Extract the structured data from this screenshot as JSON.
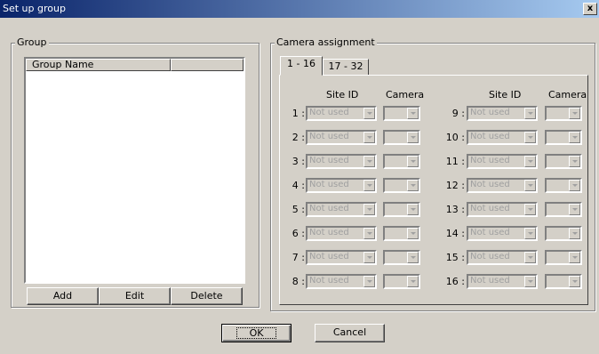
{
  "window": {
    "title": "Set up group",
    "close_label": "x"
  },
  "group": {
    "label": "Group",
    "columns": [
      "Group Name",
      ""
    ],
    "buttons": {
      "add": "Add",
      "edit": "Edit",
      "delete": "Delete"
    }
  },
  "camera": {
    "label": "Camera assignment",
    "tabs": [
      "1 - 16",
      "17 - 32"
    ],
    "headers": {
      "site": "Site ID",
      "camera": "Camera"
    },
    "left_rows": [
      {
        "label": "1 :",
        "site": "Not used"
      },
      {
        "label": "2 :",
        "site": "Not used"
      },
      {
        "label": "3 :",
        "site": "Not used"
      },
      {
        "label": "4 :",
        "site": "Not used"
      },
      {
        "label": "5 :",
        "site": "Not used"
      },
      {
        "label": "6 :",
        "site": "Not used"
      },
      {
        "label": "7 :",
        "site": "Not used"
      },
      {
        "label": "8 :",
        "site": "Not used"
      }
    ],
    "right_rows": [
      {
        "label": "9 :",
        "site": "Not used"
      },
      {
        "label": "10 :",
        "site": "Not used"
      },
      {
        "label": "11 :",
        "site": "Not used"
      },
      {
        "label": "12 :",
        "site": "Not used"
      },
      {
        "label": "13 :",
        "site": "Not used"
      },
      {
        "label": "14 :",
        "site": "Not used"
      },
      {
        "label": "15 :",
        "site": "Not used"
      },
      {
        "label": "16 :",
        "site": "Not used"
      }
    ]
  },
  "footer": {
    "ok": "OK",
    "cancel": "Cancel"
  }
}
